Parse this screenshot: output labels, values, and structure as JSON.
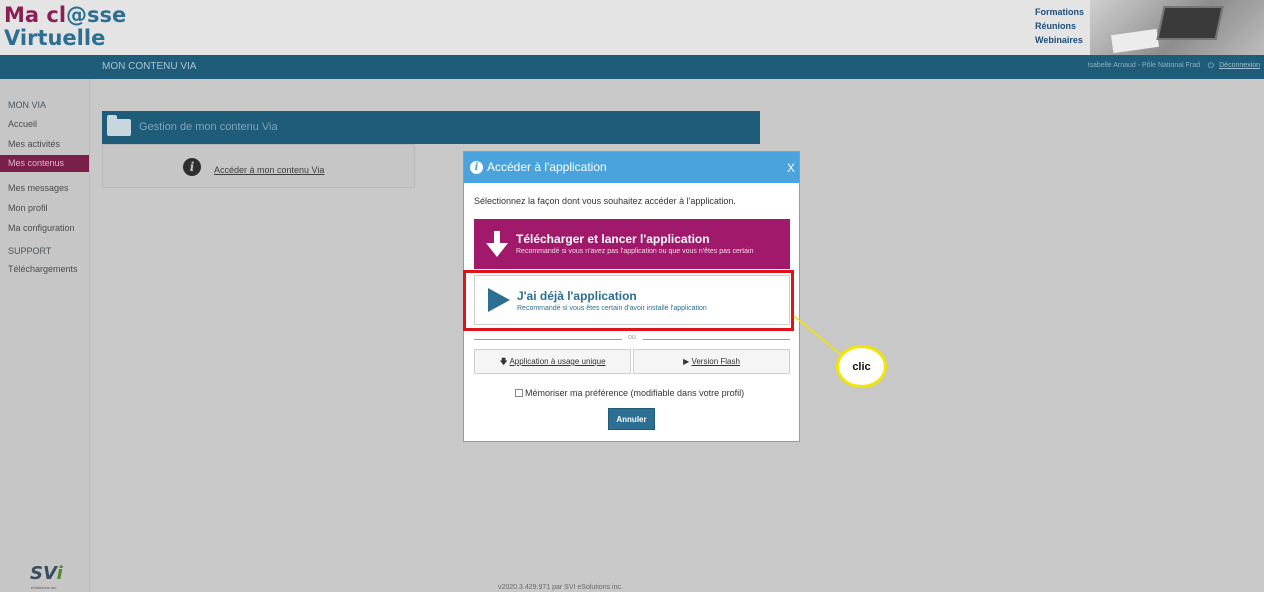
{
  "header": {
    "logo_line1_a": "Ma cl",
    "logo_line1_b": "@sse",
    "logo_line2": "Virtuelle",
    "menu": [
      "Formations",
      "Réunions",
      "Webinaires"
    ]
  },
  "topbar": {
    "section_title": "MON CONTENU VIA",
    "user": "Isabelle Arnaud - Pôle National Frad",
    "logout": "Déconnexion"
  },
  "sidebar": {
    "section1": "MON VIA",
    "items1": [
      "Accueil",
      "Mes activités",
      "Mes contenus",
      "Mes messages",
      "Mon profil",
      "Ma configuration"
    ],
    "active_index": 2,
    "section2": "SUPPORT",
    "items2": [
      "Téléchargements"
    ]
  },
  "panel": {
    "title": "Gestion de mon contenu Via",
    "link": "Accéder à mon contenu Via"
  },
  "modal": {
    "title": "Accéder à l'application",
    "close": "X",
    "instruction": "Sélectionnez la façon dont vous souhaitez accéder à l'application.",
    "download_title": "Télécharger et lancer l'application",
    "download_sub": "Recommandé si vous n'avez pas l'application ou que vous n'êtes pas certain",
    "have_title": "J'ai déjà l'application",
    "have_sub": "Recommandé si vous êtes certain d'avoir installé l'application",
    "separator": "ou",
    "single_use": "Application à usage unique",
    "flash": "Version Flash",
    "remember": "Mémoriser ma préférence (modifiable dans votre profil)",
    "cancel": "Annuler"
  },
  "callout": {
    "label": "clic",
    "color": "#f2e500"
  },
  "highlight_color": "#e0131a",
  "footer": {
    "version": "v2020.3.429.971 par SVI eSolutions inc.",
    "svi_a": "SV",
    "svi_b": "i",
    "svi_sub": "eSolutions inc."
  },
  "colors": {
    "magenta": "#a1196b",
    "blue_dark": "#1f5c7a",
    "blue_modal": "#4aa3dc"
  }
}
